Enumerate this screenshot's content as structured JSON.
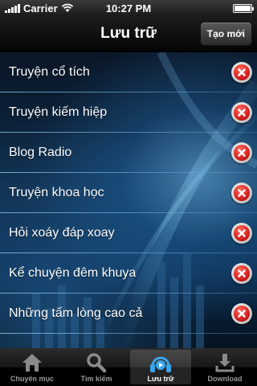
{
  "status_bar": {
    "carrier": "Carrier",
    "time": "10:27 PM",
    "battery_level": 1.0
  },
  "nav": {
    "title": "Lưu trữ",
    "right_button": "Tạo mới"
  },
  "list": [
    {
      "label": "Truyện cổ tích"
    },
    {
      "label": "Truyện kiếm hiệp"
    },
    {
      "label": "Blog Radio"
    },
    {
      "label": "Truyện khoa học"
    },
    {
      "label": "Hỏi xoáy đáp xoay"
    },
    {
      "label": "Kể chuyện đêm khuya"
    },
    {
      "label": "Những tấm lòng cao cả"
    }
  ],
  "tabs": [
    {
      "label": "Chuyên mục",
      "icon": "home-icon"
    },
    {
      "label": "Tìm kiếm",
      "icon": "search-icon"
    },
    {
      "label": "Lưu trữ",
      "icon": "headphones-icon",
      "active": true
    },
    {
      "label": "Download",
      "icon": "download-icon"
    }
  ],
  "colors": {
    "delete_red": "#d42020",
    "active_tab_icon": "#3aa6f0"
  }
}
